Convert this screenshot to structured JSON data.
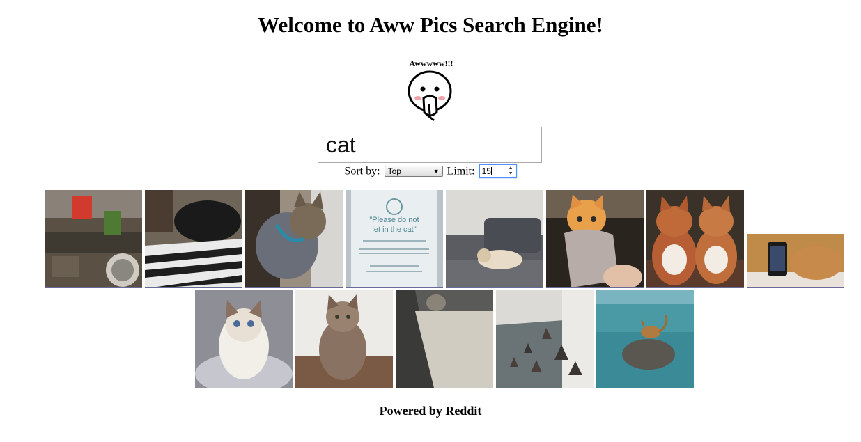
{
  "page": {
    "title": "Welcome to Aww Pics Search Engine!"
  },
  "mascot": {
    "caption": "Awwwww!!!"
  },
  "search": {
    "value": "cat"
  },
  "controls": {
    "sort_label": "Sort by:",
    "sort_value": "Top",
    "limit_label": "Limit:",
    "limit_value": "15"
  },
  "results": [
    {
      "id": 1,
      "subject": "cluttered room with cat"
    },
    {
      "id": 2,
      "subject": "black cat on striped blanket"
    },
    {
      "id": 3,
      "subject": "sphynx cat with collar"
    },
    {
      "id": 4,
      "subject": "sign: Please do not let in the cat"
    },
    {
      "id": 5,
      "subject": "cat sleeping on sofa"
    },
    {
      "id": 6,
      "subject": "orange kitten in sock"
    },
    {
      "id": 7,
      "subject": "two stuffed cat toys"
    },
    {
      "id": 8,
      "subject": "cat next to phone"
    },
    {
      "id": 9,
      "subject": "fluffy white kitten"
    },
    {
      "id": 10,
      "subject": "tabby cat sitting"
    },
    {
      "id": 11,
      "subject": "cat at window"
    },
    {
      "id": 12,
      "subject": "dinosaur toys in hallway"
    },
    {
      "id": 13,
      "subject": "cat on rock in lake"
    }
  ],
  "sign_text": {
    "line1": "\"Please do not",
    "line2": "let in the cat\""
  },
  "footer": {
    "text": "Powered by Reddit"
  }
}
